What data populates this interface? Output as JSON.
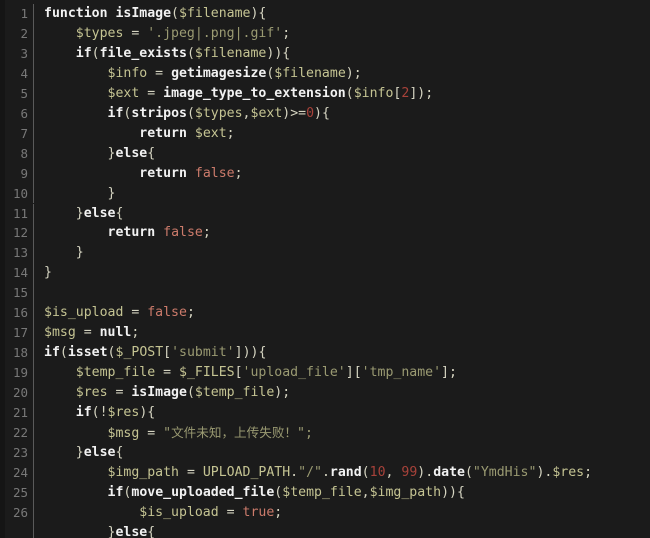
{
  "editor": {
    "language": "php",
    "background_color": "#1b1b1b",
    "gutter_text_color": "#787878",
    "default_text_color": "#c8c7a8",
    "first_line_number": 1,
    "last_line_number": 26,
    "total_visible_lines": 27
  },
  "palette": {
    "keyword": "#f2f2f2",
    "function": "#f2f2f2",
    "variable": "#c5c493",
    "string": "#9a9a72",
    "literal": "#cc7b6b",
    "number": "#a8423a",
    "punctuation": "#d6d5c2"
  },
  "lines": [
    {
      "number": "1",
      "tokens": [
        {
          "text": "function ",
          "type": "kw"
        },
        {
          "text": "isImage",
          "type": "fn"
        },
        {
          "text": "(",
          "type": "punct"
        },
        {
          "text": "$filename",
          "type": "var"
        },
        {
          "text": "){",
          "type": "punct"
        }
      ]
    },
    {
      "number": "2",
      "tokens": [
        {
          "text": "    ",
          "type": "punct"
        },
        {
          "text": "$types",
          "type": "var"
        },
        {
          "text": " = ",
          "type": "punct"
        },
        {
          "text": "'.jpeg|.png|.gif'",
          "type": "str"
        },
        {
          "text": ";",
          "type": "punct"
        }
      ]
    },
    {
      "number": "3",
      "tokens": [
        {
          "text": "    ",
          "type": "punct"
        },
        {
          "text": "if",
          "type": "kw"
        },
        {
          "text": "(",
          "type": "punct"
        },
        {
          "text": "file_exists",
          "type": "fn"
        },
        {
          "text": "(",
          "type": "punct"
        },
        {
          "text": "$filename",
          "type": "var"
        },
        {
          "text": ")){",
          "type": "punct"
        }
      ]
    },
    {
      "number": "4",
      "tokens": [
        {
          "text": "        ",
          "type": "punct"
        },
        {
          "text": "$info",
          "type": "var"
        },
        {
          "text": " = ",
          "type": "punct"
        },
        {
          "text": "getimagesize",
          "type": "fn"
        },
        {
          "text": "(",
          "type": "punct"
        },
        {
          "text": "$filename",
          "type": "var"
        },
        {
          "text": ");",
          "type": "punct"
        }
      ]
    },
    {
      "number": "5",
      "tokens": [
        {
          "text": "        ",
          "type": "punct"
        },
        {
          "text": "$ext",
          "type": "var"
        },
        {
          "text": " = ",
          "type": "punct"
        },
        {
          "text": "image_type_to_extension",
          "type": "fn"
        },
        {
          "text": "(",
          "type": "punct"
        },
        {
          "text": "$info",
          "type": "var"
        },
        {
          "text": "[",
          "type": "punct"
        },
        {
          "text": "2",
          "type": "num"
        },
        {
          "text": "]);",
          "type": "punct"
        }
      ]
    },
    {
      "number": "6",
      "tokens": [
        {
          "text": "        ",
          "type": "punct"
        },
        {
          "text": "if",
          "type": "kw"
        },
        {
          "text": "(",
          "type": "punct"
        },
        {
          "text": "stripos",
          "type": "fn"
        },
        {
          "text": "(",
          "type": "punct"
        },
        {
          "text": "$types",
          "type": "var"
        },
        {
          "text": ",",
          "type": "punct"
        },
        {
          "text": "$ext",
          "type": "var"
        },
        {
          "text": ")>=",
          "type": "punct"
        },
        {
          "text": "0",
          "type": "num"
        },
        {
          "text": "){",
          "type": "punct"
        }
      ]
    },
    {
      "number": "7",
      "tokens": [
        {
          "text": "            ",
          "type": "punct"
        },
        {
          "text": "return",
          "type": "kw"
        },
        {
          "text": " ",
          "type": "punct"
        },
        {
          "text": "$ext",
          "type": "var"
        },
        {
          "text": ";",
          "type": "punct"
        }
      ]
    },
    {
      "number": "8",
      "tokens": [
        {
          "text": "        }",
          "type": "punct"
        },
        {
          "text": "else",
          "type": "kw"
        },
        {
          "text": "{",
          "type": "punct"
        }
      ]
    },
    {
      "number": "9",
      "tokens": [
        {
          "text": "            ",
          "type": "punct"
        },
        {
          "text": "return",
          "type": "kw"
        },
        {
          "text": " ",
          "type": "punct"
        },
        {
          "text": "false",
          "type": "lit"
        },
        {
          "text": ";",
          "type": "punct"
        }
      ]
    },
    {
      "number": "10",
      "tokens": [
        {
          "text": "        }",
          "type": "punct"
        }
      ]
    },
    {
      "number": "11",
      "tokens": [
        {
          "text": "    }",
          "type": "punct"
        },
        {
          "text": "else",
          "type": "kw"
        },
        {
          "text": "{",
          "type": "punct"
        }
      ]
    },
    {
      "number": "12",
      "tokens": [
        {
          "text": "        ",
          "type": "punct"
        },
        {
          "text": "return",
          "type": "kw"
        },
        {
          "text": " ",
          "type": "punct"
        },
        {
          "text": "false",
          "type": "lit"
        },
        {
          "text": ";",
          "type": "punct"
        }
      ]
    },
    {
      "number": "13",
      "tokens": [
        {
          "text": "    }",
          "type": "punct"
        }
      ]
    },
    {
      "number": "14",
      "tokens": [
        {
          "text": "}",
          "type": "punct"
        }
      ]
    },
    {
      "number": "15",
      "tokens": [
        {
          "text": "",
          "type": "punct"
        }
      ]
    },
    {
      "number": "16",
      "tokens": [
        {
          "text": "$is_upload",
          "type": "var"
        },
        {
          "text": " = ",
          "type": "punct"
        },
        {
          "text": "false",
          "type": "lit"
        },
        {
          "text": ";",
          "type": "punct"
        }
      ]
    },
    {
      "number": "17",
      "tokens": [
        {
          "text": "$msg",
          "type": "var"
        },
        {
          "text": " = ",
          "type": "punct"
        },
        {
          "text": "null",
          "type": "kw"
        },
        {
          "text": ";",
          "type": "punct"
        }
      ]
    },
    {
      "number": "18",
      "tokens": [
        {
          "text": "if",
          "type": "kw"
        },
        {
          "text": "(",
          "type": "punct"
        },
        {
          "text": "isset",
          "type": "fn"
        },
        {
          "text": "(",
          "type": "punct"
        },
        {
          "text": "$_POST",
          "type": "var"
        },
        {
          "text": "[",
          "type": "punct"
        },
        {
          "text": "'submit'",
          "type": "str"
        },
        {
          "text": "])){",
          "type": "punct"
        }
      ]
    },
    {
      "number": "19",
      "tokens": [
        {
          "text": "    ",
          "type": "punct"
        },
        {
          "text": "$temp_file",
          "type": "var"
        },
        {
          "text": " = ",
          "type": "punct"
        },
        {
          "text": "$_FILES",
          "type": "var"
        },
        {
          "text": "[",
          "type": "punct"
        },
        {
          "text": "'upload_file'",
          "type": "str"
        },
        {
          "text": "][",
          "type": "punct"
        },
        {
          "text": "'tmp_name'",
          "type": "str"
        },
        {
          "text": "];",
          "type": "punct"
        }
      ]
    },
    {
      "number": "20",
      "tokens": [
        {
          "text": "    ",
          "type": "punct"
        },
        {
          "text": "$res",
          "type": "var"
        },
        {
          "text": " = ",
          "type": "punct"
        },
        {
          "text": "isImage",
          "type": "fn"
        },
        {
          "text": "(",
          "type": "punct"
        },
        {
          "text": "$temp_file",
          "type": "var"
        },
        {
          "text": ");",
          "type": "punct"
        }
      ]
    },
    {
      "number": "21",
      "tokens": [
        {
          "text": "    ",
          "type": "punct"
        },
        {
          "text": "if",
          "type": "kw"
        },
        {
          "text": "(!",
          "type": "punct"
        },
        {
          "text": "$res",
          "type": "var"
        },
        {
          "text": "){",
          "type": "punct"
        }
      ]
    },
    {
      "number": "22",
      "tokens": [
        {
          "text": "        ",
          "type": "punct"
        },
        {
          "text": "$msg",
          "type": "var"
        },
        {
          "text": " = ",
          "type": "punct"
        },
        {
          "text": "\"",
          "type": "str"
        },
        {
          "text": "文件未知，上传失败！",
          "type": "cjk"
        },
        {
          "text": "\";",
          "type": "str"
        }
      ]
    },
    {
      "number": "23",
      "tokens": [
        {
          "text": "    }",
          "type": "punct"
        },
        {
          "text": "else",
          "type": "kw"
        },
        {
          "text": "{",
          "type": "punct"
        }
      ]
    },
    {
      "number": "24",
      "tokens": [
        {
          "text": "        ",
          "type": "punct"
        },
        {
          "text": "$img_path",
          "type": "var"
        },
        {
          "text": " = ",
          "type": "punct"
        },
        {
          "text": "UPLOAD_PATH",
          "type": "var"
        },
        {
          "text": ".",
          "type": "punct"
        },
        {
          "text": "\"/\"",
          "type": "str"
        },
        {
          "text": ".",
          "type": "punct"
        },
        {
          "text": "rand",
          "type": "fn"
        },
        {
          "text": "(",
          "type": "punct"
        },
        {
          "text": "10",
          "type": "num"
        },
        {
          "text": ", ",
          "type": "punct"
        },
        {
          "text": "99",
          "type": "num"
        },
        {
          "text": ").",
          "type": "punct"
        },
        {
          "text": "date",
          "type": "fn"
        },
        {
          "text": "(",
          "type": "punct"
        },
        {
          "text": "\"YmdHis\"",
          "type": "str"
        },
        {
          "text": ").",
          "type": "punct"
        },
        {
          "text": "$res",
          "type": "var"
        },
        {
          "text": ";",
          "type": "punct"
        }
      ]
    },
    {
      "number": "25",
      "tokens": [
        {
          "text": "        ",
          "type": "punct"
        },
        {
          "text": "if",
          "type": "kw"
        },
        {
          "text": "(",
          "type": "punct"
        },
        {
          "text": "move_uploaded_file",
          "type": "fn"
        },
        {
          "text": "(",
          "type": "punct"
        },
        {
          "text": "$temp_file",
          "type": "var"
        },
        {
          "text": ",",
          "type": "punct"
        },
        {
          "text": "$img_path",
          "type": "var"
        },
        {
          "text": ")){",
          "type": "punct"
        }
      ]
    },
    {
      "number": "26",
      "tokens": [
        {
          "text": "            ",
          "type": "punct"
        },
        {
          "text": "$is_upload",
          "type": "var"
        },
        {
          "text": " = ",
          "type": "punct"
        },
        {
          "text": "true",
          "type": "lit"
        },
        {
          "text": ";",
          "type": "punct"
        }
      ]
    },
    {
      "number": "",
      "tokens": [
        {
          "text": "        }",
          "type": "punct"
        },
        {
          "text": "else",
          "type": "kw"
        },
        {
          "text": "{",
          "type": "punct"
        }
      ]
    }
  ]
}
